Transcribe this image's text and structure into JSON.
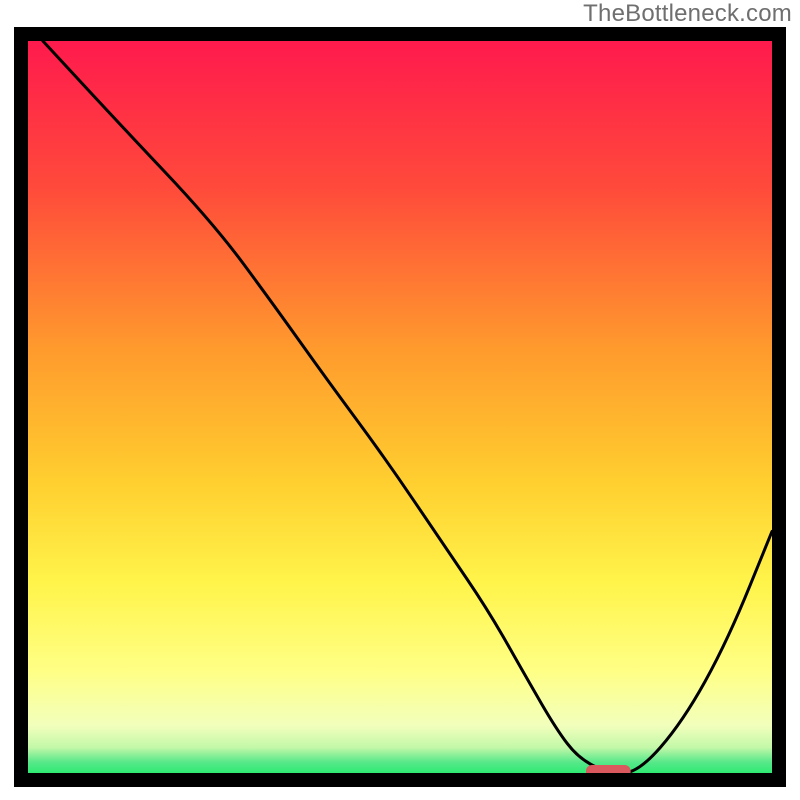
{
  "watermark": "TheBottleneck.com",
  "colors": {
    "gradient_top": "#ff1a4d",
    "gradient_upper_mid": "#ff8a2a",
    "gradient_mid": "#ffd233",
    "gradient_lower_mid": "#ffff72",
    "gradient_low": "#f3ffb8",
    "gradient_green": "#2eea73",
    "frame": "#000000",
    "curve": "#000000",
    "marker": "#d9595f"
  },
  "chart_data": {
    "type": "line",
    "title": "",
    "xlabel": "",
    "ylabel": "",
    "xlim": [
      0,
      100
    ],
    "ylim": [
      0,
      100
    ],
    "x": [
      2,
      12,
      25,
      33,
      40,
      48,
      56,
      62,
      67,
      71,
      74,
      78,
      82,
      88,
      94,
      100
    ],
    "values": [
      100,
      89,
      75,
      64,
      54,
      43,
      31,
      22,
      13,
      6,
      2,
      0,
      0,
      7,
      18,
      33
    ],
    "minimum_marker": {
      "x_start": 75,
      "x_end": 81,
      "y": 0
    }
  }
}
